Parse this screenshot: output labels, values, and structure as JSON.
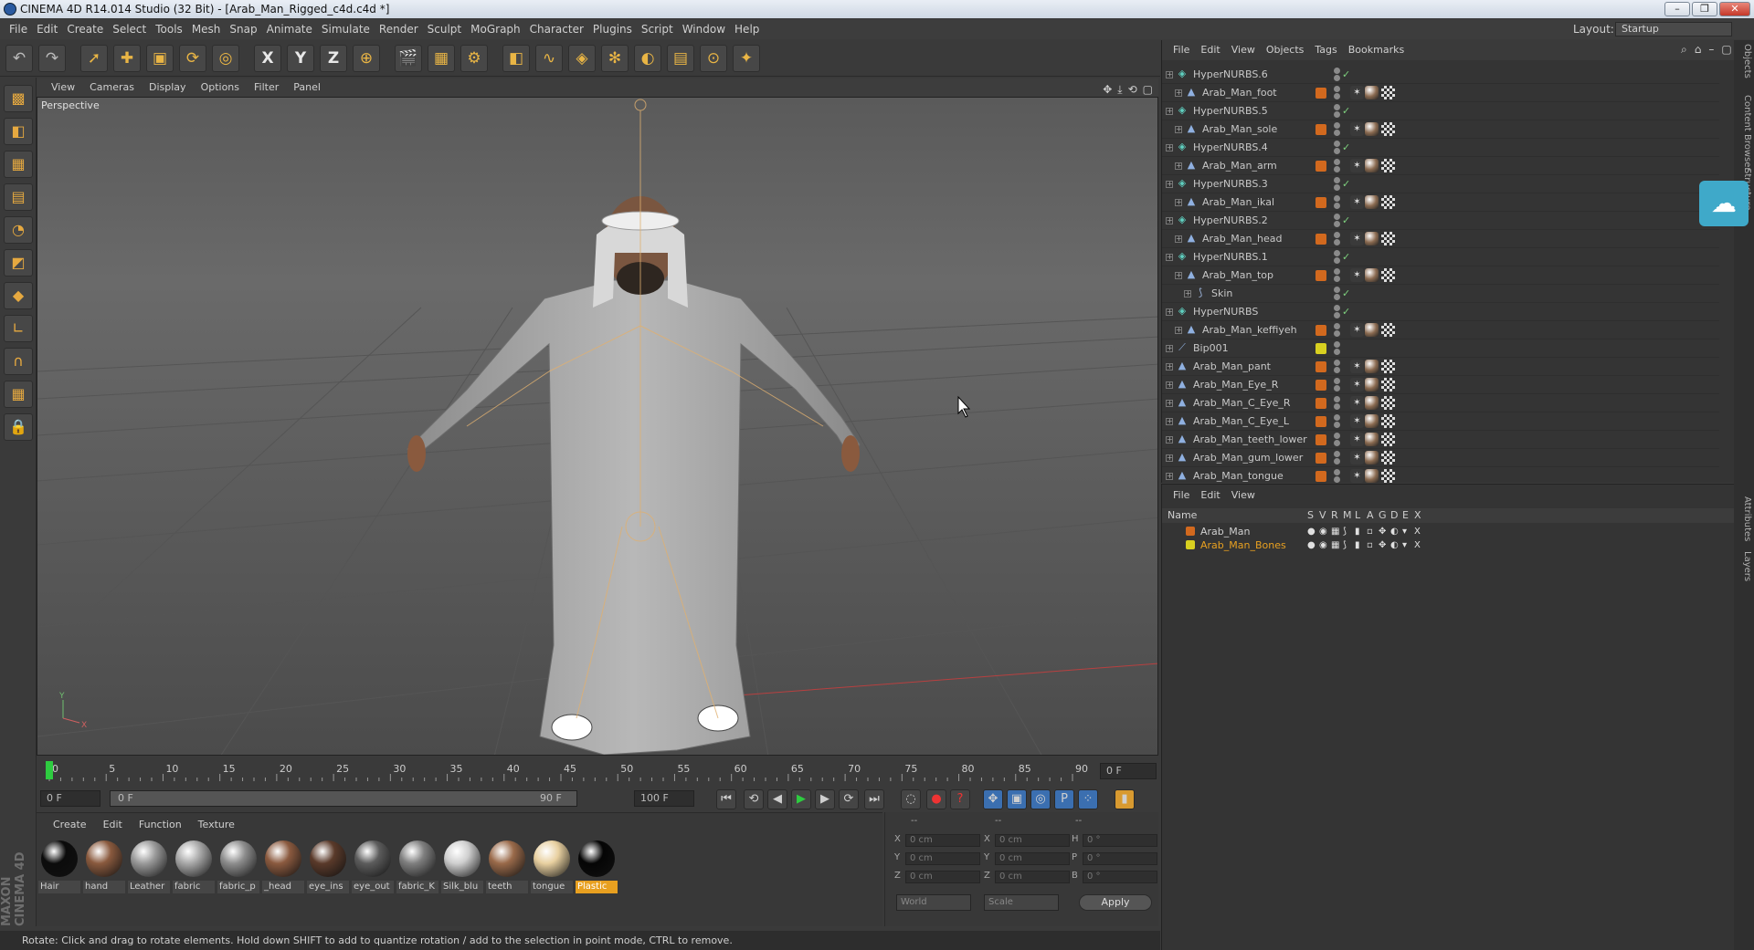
{
  "window": {
    "title": "CINEMA 4D R14.014 Studio (32 Bit) - [Arab_Man_Rigged_c4d.c4d *]",
    "minimize_icon": "minimize-icon",
    "restore_icon": "restore-icon",
    "close_icon": "close-icon"
  },
  "menubar": {
    "items": [
      "File",
      "Edit",
      "Create",
      "Select",
      "Tools",
      "Mesh",
      "Snap",
      "Animate",
      "Simulate",
      "Render",
      "Sculpt",
      "MoGraph",
      "Character",
      "Plugins",
      "Script",
      "Window",
      "Help"
    ],
    "layout_label": "Layout:",
    "layout_value": "Startup"
  },
  "toolbar": {
    "icons": [
      "undo-icon",
      "redo-icon",
      "select-icon",
      "move-icon",
      "scale-icon",
      "rotate-icon",
      "live-select-icon",
      "x-axis-icon",
      "y-axis-icon",
      "z-axis-icon",
      "world-coord-icon",
      "render-view-icon",
      "render-picture-viewer-icon",
      "render-settings-icon",
      "cube-icon",
      "spline-icon",
      "nurbs-icon",
      "array-icon",
      "deformer-icon",
      "floor-icon",
      "camera-icon",
      "light-icon"
    ],
    "axis_labels": [
      "X",
      "Y",
      "Z"
    ]
  },
  "left_tools": {
    "icons": [
      "make-editable-icon",
      "model-mode-icon",
      "texture-mode-icon",
      "workplane-icon",
      "points-mode-icon",
      "edges-mode-icon",
      "polygons-mode-icon",
      "axis-mode-icon",
      "magnet-icon",
      "snap-grid-icon",
      "lock-icon"
    ]
  },
  "brand": "MAXON CINEMA 4D",
  "viewport": {
    "menu": [
      "View",
      "Cameras",
      "Display",
      "Options",
      "Filter",
      "Panel"
    ],
    "label": "Perspective",
    "nav_icons": [
      "move-view-icon",
      "zoom-view-icon",
      "rotate-view-icon",
      "maximize-view-icon"
    ]
  },
  "timeline": {
    "ticks": [
      "0",
      "5",
      "10",
      "15",
      "20",
      "25",
      "30",
      "35",
      "40",
      "45",
      "50",
      "55",
      "60",
      "65",
      "70",
      "75",
      "80",
      "85",
      "90"
    ],
    "current_frame": "0 F",
    "start_field": "0 F",
    "range_start": "0 F",
    "range_end": "90 F",
    "end_field": "100 F"
  },
  "transport": {
    "icons": [
      "go-start-icon",
      "prev-key-icon",
      "prev-frame-icon",
      "play-icon",
      "next-frame-icon",
      "next-key-icon",
      "go-end-icon",
      "record-icon",
      "autokey-icon",
      "keyframe-selection-icon",
      "position-key-icon",
      "scale-key-icon",
      "rotation-key-icon",
      "param-key-icon",
      "pla-key-icon",
      "timeline-icon"
    ]
  },
  "materials": {
    "menu": [
      "Create",
      "Edit",
      "Function",
      "Texture"
    ],
    "items": [
      {
        "label": "Hair",
        "color": "#0b0b0b"
      },
      {
        "label": "hand",
        "color": "#8a5a3e"
      },
      {
        "label": "Leather",
        "color": "#9a9a9a"
      },
      {
        "label": "fabric",
        "color": "#a8a8a8"
      },
      {
        "label": "fabric_p",
        "color": "#8e8e8e"
      },
      {
        "label": "_head",
        "color": "#8b5a3f"
      },
      {
        "label": "eye_ins",
        "color": "#5a3a2a"
      },
      {
        "label": "eye_out",
        "color": "#5c5c5c"
      },
      {
        "label": "fabric_K",
        "color": "#7f7f7f"
      },
      {
        "label": "Silk_blu",
        "color": "#cfcfcf"
      },
      {
        "label": "teeth",
        "color": "#9a6a4a"
      },
      {
        "label": "tongue",
        "color": "#e8d0a0"
      },
      {
        "label": "Plastic",
        "color": "#050505"
      }
    ],
    "selected": "Plastic"
  },
  "coordinates": {
    "header_left": "--",
    "header_mid": "--",
    "header_right": "--",
    "rows": [
      {
        "a": "X",
        "av": "0 cm",
        "b": "X",
        "bv": "0 cm",
        "c": "H",
        "cv": "0 °"
      },
      {
        "a": "Y",
        "av": "0 cm",
        "b": "Y",
        "bv": "0 cm",
        "c": "P",
        "cv": "0 °"
      },
      {
        "a": "Z",
        "av": "0 cm",
        "b": "Z",
        "bv": "0 cm",
        "c": "B",
        "cv": "0 °"
      }
    ],
    "mode_select": "World",
    "size_select": "Scale",
    "apply_label": "Apply"
  },
  "status": "Rotate: Click and drag to rotate elements. Hold down SHIFT to add to quantize rotation / add to the selection in point mode, CTRL to remove.",
  "object_manager": {
    "menu": [
      "File",
      "Edit",
      "View",
      "Objects",
      "Tags",
      "Bookmarks"
    ],
    "icons": [
      "search-icon",
      "home-icon",
      "collapse-icon",
      "new-window-icon"
    ],
    "rows": [
      {
        "name": "HyperNURBS.6",
        "indent": 0,
        "type": "nurbs",
        "layer": "",
        "tags": false
      },
      {
        "name": "Arab_Man_foot",
        "indent": 1,
        "type": "mesh",
        "layer": "#d2691e",
        "tags": true
      },
      {
        "name": "HyperNURBS.5",
        "indent": 0,
        "type": "nurbs",
        "layer": "",
        "tags": false
      },
      {
        "name": "Arab_Man_sole",
        "indent": 1,
        "type": "mesh",
        "layer": "#d2691e",
        "tags": true
      },
      {
        "name": "HyperNURBS.4",
        "indent": 0,
        "type": "nurbs",
        "layer": "",
        "tags": false
      },
      {
        "name": "Arab_Man_arm",
        "indent": 1,
        "type": "mesh",
        "layer": "#d2691e",
        "tags": true
      },
      {
        "name": "HyperNURBS.3",
        "indent": 0,
        "type": "nurbs",
        "layer": "",
        "tags": false
      },
      {
        "name": "Arab_Man_ikal",
        "indent": 1,
        "type": "mesh",
        "layer": "#d2691e",
        "tags": true
      },
      {
        "name": "HyperNURBS.2",
        "indent": 0,
        "type": "nurbs",
        "layer": "",
        "tags": false
      },
      {
        "name": "Arab_Man_head",
        "indent": 1,
        "type": "mesh",
        "layer": "#d2691e",
        "tags": true
      },
      {
        "name": "HyperNURBS.1",
        "indent": 0,
        "type": "nurbs",
        "layer": "",
        "tags": false
      },
      {
        "name": "Arab_Man_top",
        "indent": 1,
        "type": "mesh",
        "layer": "#d2691e",
        "tags": true
      },
      {
        "name": "Skin",
        "indent": 2,
        "type": "skin",
        "layer": "",
        "tags": false
      },
      {
        "name": "HyperNURBS",
        "indent": 0,
        "type": "nurbs",
        "layer": "",
        "tags": false
      },
      {
        "name": "Arab_Man_keffiyeh",
        "indent": 1,
        "type": "mesh",
        "layer": "#d2691e",
        "tags": true
      },
      {
        "name": "Bip001",
        "indent": 0,
        "type": "bone",
        "layer": "#d8d020",
        "tags": false
      },
      {
        "name": "Arab_Man_pant",
        "indent": 0,
        "type": "mesh",
        "layer": "#d2691e",
        "tags": true
      },
      {
        "name": "Arab_Man_Eye_R",
        "indent": 0,
        "type": "mesh",
        "layer": "#d2691e",
        "tags": true
      },
      {
        "name": "Arab_Man_C_Eye_R",
        "indent": 0,
        "type": "mesh",
        "layer": "#d2691e",
        "tags": true
      },
      {
        "name": "Arab_Man_C_Eye_L",
        "indent": 0,
        "type": "mesh",
        "layer": "#d2691e",
        "tags": true
      },
      {
        "name": "Arab_Man_teeth_lower",
        "indent": 0,
        "type": "mesh",
        "layer": "#d2691e",
        "tags": true
      },
      {
        "name": "Arab_Man_gum_lower",
        "indent": 0,
        "type": "mesh",
        "layer": "#d2691e",
        "tags": true
      },
      {
        "name": "Arab_Man_tongue",
        "indent": 0,
        "type": "mesh",
        "layer": "#d2691e",
        "tags": true
      }
    ]
  },
  "layer_manager": {
    "menu": [
      "File",
      "Edit",
      "View"
    ],
    "columns": [
      "Name",
      "S",
      "V",
      "R",
      "M",
      "L",
      "A",
      "G",
      "D",
      "E",
      "X"
    ],
    "rows": [
      {
        "name": "Arab_Man",
        "color": "#d2691e",
        "highlight": false
      },
      {
        "name": "Arab_Man_Bones",
        "color": "#d8d020",
        "highlight": true
      }
    ]
  },
  "side_tabs": [
    "Objects",
    "Content Browser",
    "Structure",
    "Attributes",
    "Layers"
  ],
  "cloud_icon": "cloud-upload-icon"
}
